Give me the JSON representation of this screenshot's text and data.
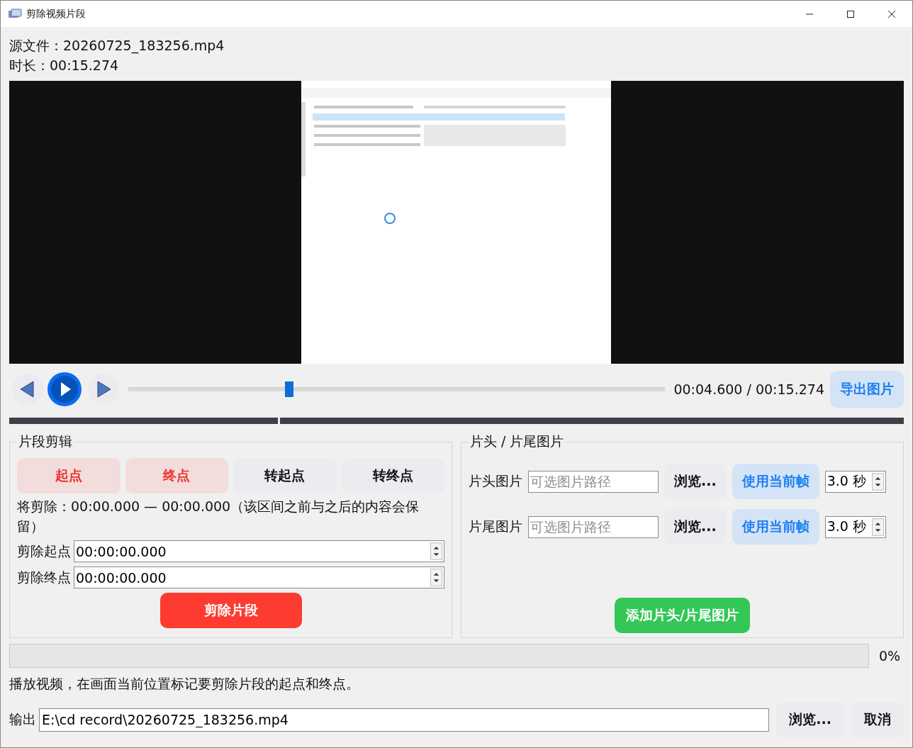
{
  "window": {
    "title": "剪除视频片段"
  },
  "info": {
    "source": "源文件：20260725_183256.mp4",
    "duration": "时长：00:15.274"
  },
  "player": {
    "level": 0.3,
    "time": "00:04.600 / 00:15.274",
    "export_button": "导出图片"
  },
  "clip_edit": {
    "title": "片段剪辑",
    "mark_buttons": [
      {
        "label": "起点",
        "kind": "mark"
      },
      {
        "label": "终点",
        "kind": "mark"
      },
      {
        "label": "转起点",
        "kind": "jump"
      },
      {
        "label": "转终点",
        "kind": "jump"
      }
    ],
    "summary": "将剪除：00:00.000 — 00:00.000（该区间之前与之后的内容会保留）",
    "fields": [
      {
        "label": "剪除起点",
        "value": "00:00:00.000"
      },
      {
        "label": "剪除终点",
        "value": "00:00:00.000"
      }
    ],
    "cut_button": "剪除片段"
  },
  "images": {
    "title": "片头 / 片尾图片",
    "rows": [
      {
        "label": "片头图片",
        "placeholder": "可选图片路径",
        "browse": "浏览...",
        "use_frame": "使用当前帧",
        "duration": "3.0 秒"
      },
      {
        "label": "片尾图片",
        "placeholder": "可选图片路径",
        "browse": "浏览...",
        "use_frame": "使用当前帧",
        "duration": "3.0 秒"
      }
    ],
    "add_button": "添加片头/片尾图片"
  },
  "progress": {
    "level": 0,
    "reading": "0%"
  },
  "status": "播放视频，在画面当前位置标记要剪除片段的起点和终点。",
  "output": {
    "label": "输出",
    "value": "E:\\cd record\\20260725_183256.mp4",
    "browse": "浏览...",
    "cancel": "取消"
  }
}
